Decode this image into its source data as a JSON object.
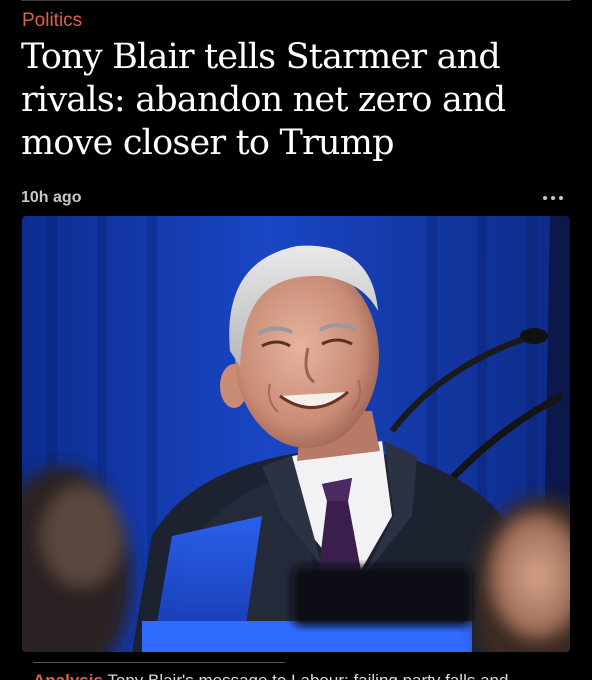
{
  "article": {
    "section": "Politics",
    "headline": "Tony Blair tells Starmer and rivals: abandon net zero and move closer to Trump",
    "timestamp": "10h ago",
    "more_label": "…",
    "photo_alt": "Photo of Tony Blair",
    "caption_kicker": "Analysis",
    "caption_text": "Tony Blair's message to Labour: failing party falls and"
  },
  "colors": {
    "accent": "#e05e4e",
    "background": "#000000",
    "headline": "#ffffff",
    "meta": "#c8c8c8"
  },
  "icons": {
    "more": "more-horizontal-icon"
  }
}
